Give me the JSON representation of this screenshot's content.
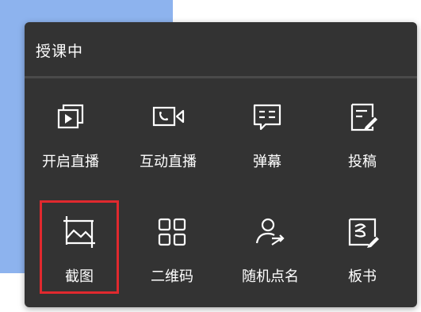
{
  "panel": {
    "title": "授课中",
    "highlight_color": "#e0292e"
  },
  "tools": [
    {
      "label": "开启直播",
      "icon": "live-stream-icon"
    },
    {
      "label": "互动直播",
      "icon": "video-call-icon"
    },
    {
      "label": "弹幕",
      "icon": "bullet-comment-icon"
    },
    {
      "label": "投稿",
      "icon": "submit-edit-icon"
    },
    {
      "label": "截图",
      "icon": "screenshot-image-icon",
      "selected": true
    },
    {
      "label": "二维码",
      "icon": "qr-code-icon"
    },
    {
      "label": "随机点名",
      "icon": "random-rollcall-icon"
    },
    {
      "label": "板书",
      "icon": "blackboard-writing-icon"
    }
  ]
}
